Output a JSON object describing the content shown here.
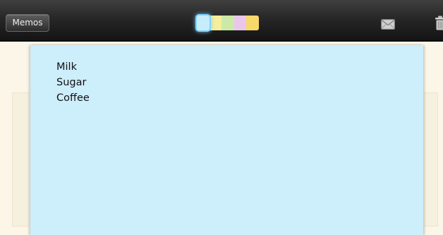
{
  "header": {
    "memos_button_label": "Memos"
  },
  "colors": {
    "swatches": [
      "#c9ecfb",
      "#f6ee9a",
      "#cde9a7",
      "#eac7ea",
      "#f7d86a"
    ],
    "selected_swatch": 0,
    "memo_background": "#cdeefb"
  },
  "icons": {
    "mail": "mail-icon",
    "trash": "trash-icon"
  },
  "memo": {
    "lines": [
      "Milk",
      "Sugar",
      "Coffee"
    ]
  }
}
